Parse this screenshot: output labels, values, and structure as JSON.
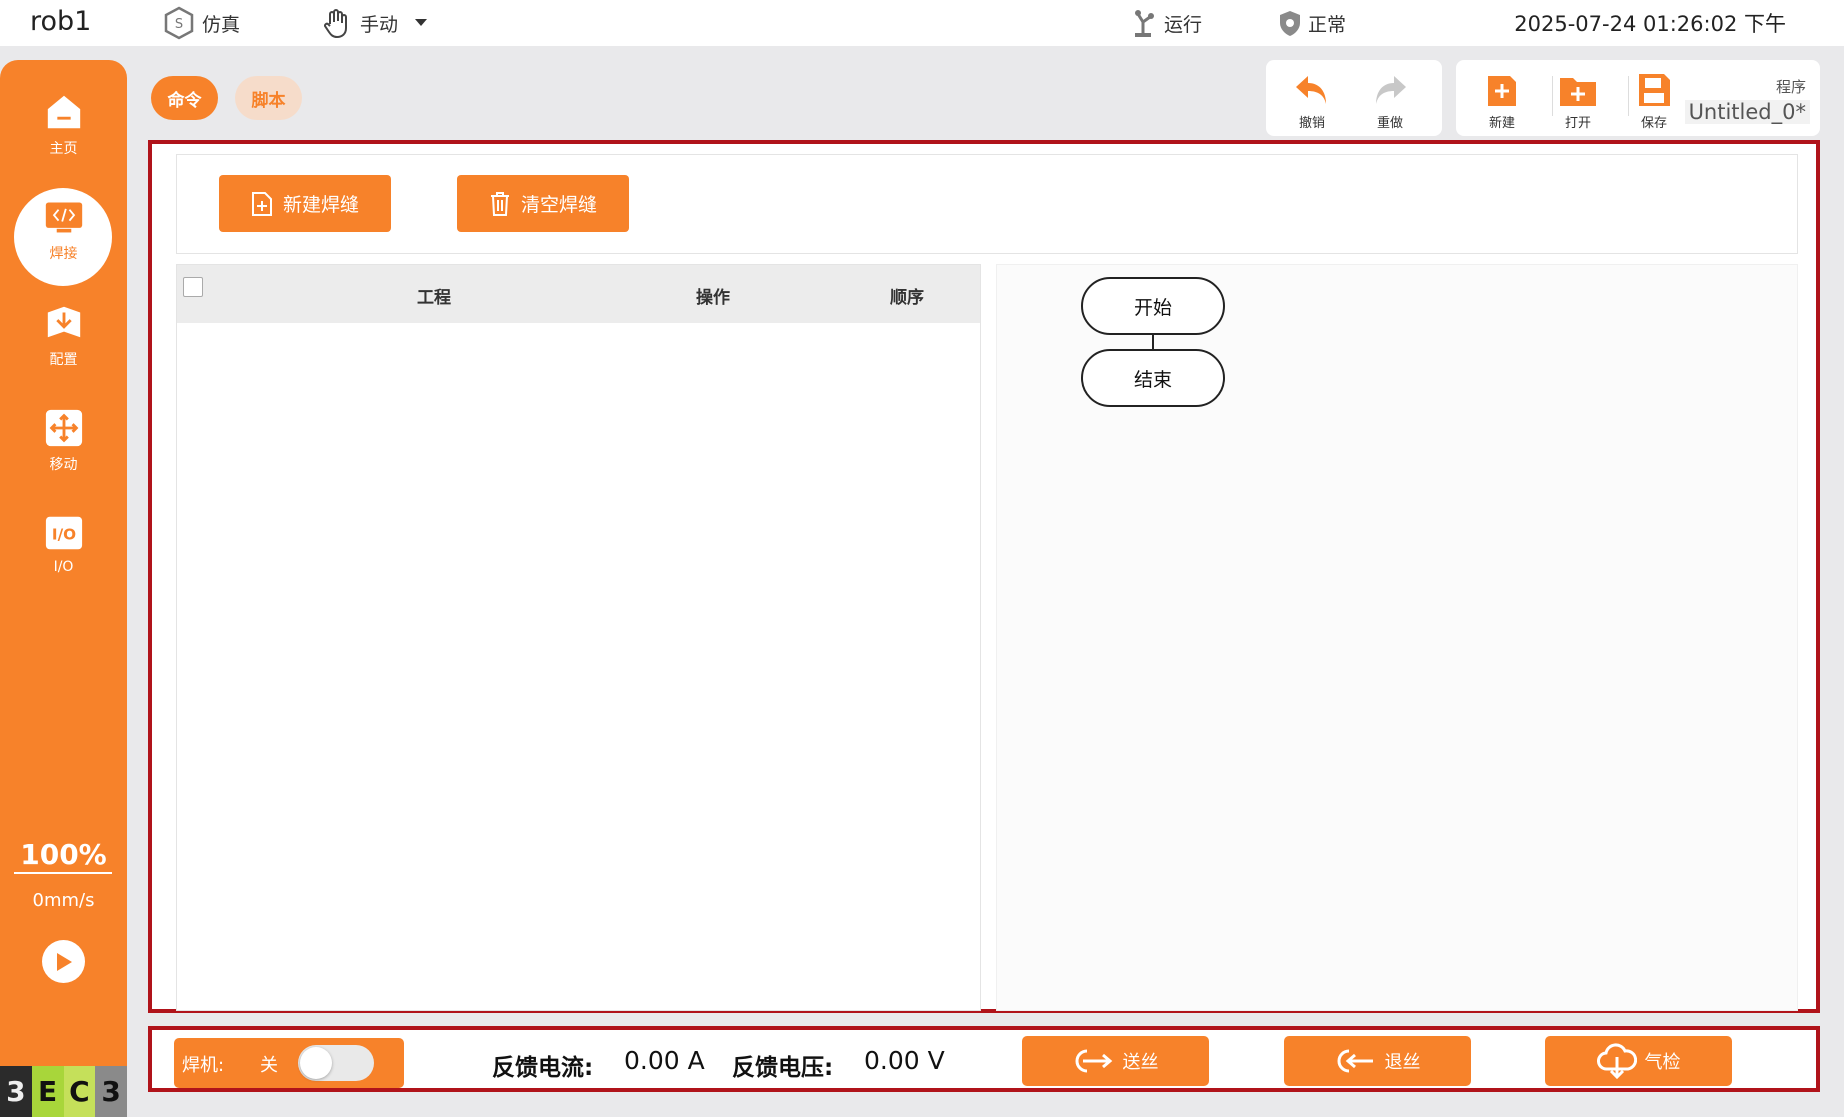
{
  "header": {
    "robot_name": "rob1",
    "sim_label": "仿真",
    "mode_label": "手动",
    "run_label": "运行",
    "status_label": "正常",
    "datetime": "2025-07-24 01:26:02 下午"
  },
  "sidebar": {
    "items": [
      {
        "label": "主页",
        "icon": "home-icon"
      },
      {
        "label": "焊接",
        "icon": "code-icon"
      },
      {
        "label": "配置",
        "icon": "download-icon"
      },
      {
        "label": "移动",
        "icon": "move-icon"
      },
      {
        "label": "I/O",
        "icon": "io-icon"
      }
    ],
    "speed_percent": "100%",
    "speed_value": "0mm/s",
    "logo": [
      "3",
      "E",
      "C",
      "3"
    ]
  },
  "tabs": {
    "command": "命令",
    "script": "脚本"
  },
  "toolbar": {
    "undo": "撤销",
    "redo": "重做",
    "new": "新建",
    "open": "打开",
    "save": "保存",
    "program_label": "程序",
    "program_name": "Untitled_0*"
  },
  "actions": {
    "new_seam": "新建焊缝",
    "clear_seam": "清空焊缝"
  },
  "table": {
    "columns": [
      "工程",
      "操作",
      "顺序"
    ],
    "rows": []
  },
  "flow": {
    "start": "开始",
    "end": "结束"
  },
  "bottom": {
    "welder_label": "焊机:",
    "welder_state": "关",
    "current_label": "反馈电流:",
    "current_value": "0.00 A",
    "voltage_label": "反馈电压:",
    "voltage_value": "0.00 V",
    "feed_wire": "送丝",
    "retract_wire": "退丝",
    "gas_check": "气检"
  },
  "colors": {
    "accent": "#f7822a",
    "highlight_border": "#b0131a"
  }
}
